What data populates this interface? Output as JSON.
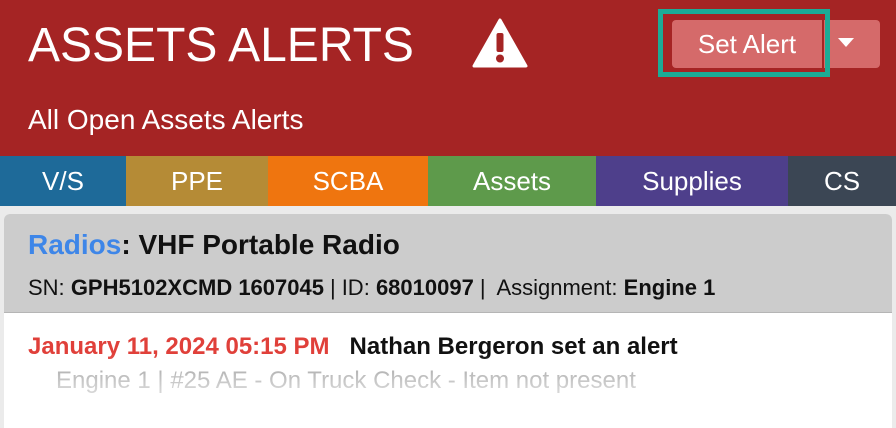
{
  "header": {
    "title": "ASSETS ALERTS",
    "subtitle": "All Open Assets Alerts",
    "warning_icon": "warning-triangle-icon",
    "set_alert_label": "Set Alert",
    "dropdown_icon": "caret-down-icon",
    "colors": {
      "background": "#a52424",
      "button": "#d56a6a",
      "focus_ring": "#1cab96"
    }
  },
  "tabs": [
    {
      "label": "V/S",
      "color": "#1e6a99"
    },
    {
      "label": "PPE",
      "color": "#b58b36"
    },
    {
      "label": "SCBA",
      "color": "#ef750f"
    },
    {
      "label": "Assets",
      "color": "#5e9a4b"
    },
    {
      "label": "Supplies",
      "color": "#4e3f8b"
    },
    {
      "label": "CS",
      "color": "#3b4654"
    }
  ],
  "card": {
    "category": "Radios",
    "item": ": VHF Portable Radio",
    "sn_label": "SN:",
    "sn_value": "GPH5102XCMD 1607045",
    "id_label": "ID:",
    "id_value": "68010097",
    "assignment_label": "Assignment:",
    "assignment_value": "Engine 1",
    "separator": "|",
    "alert": {
      "datetime": "January 11, 2024 05:15 PM",
      "message": "Nathan Bergeron set an alert",
      "detail": "Engine 1 | #25 AE - On Truck Check - Item not present"
    }
  }
}
